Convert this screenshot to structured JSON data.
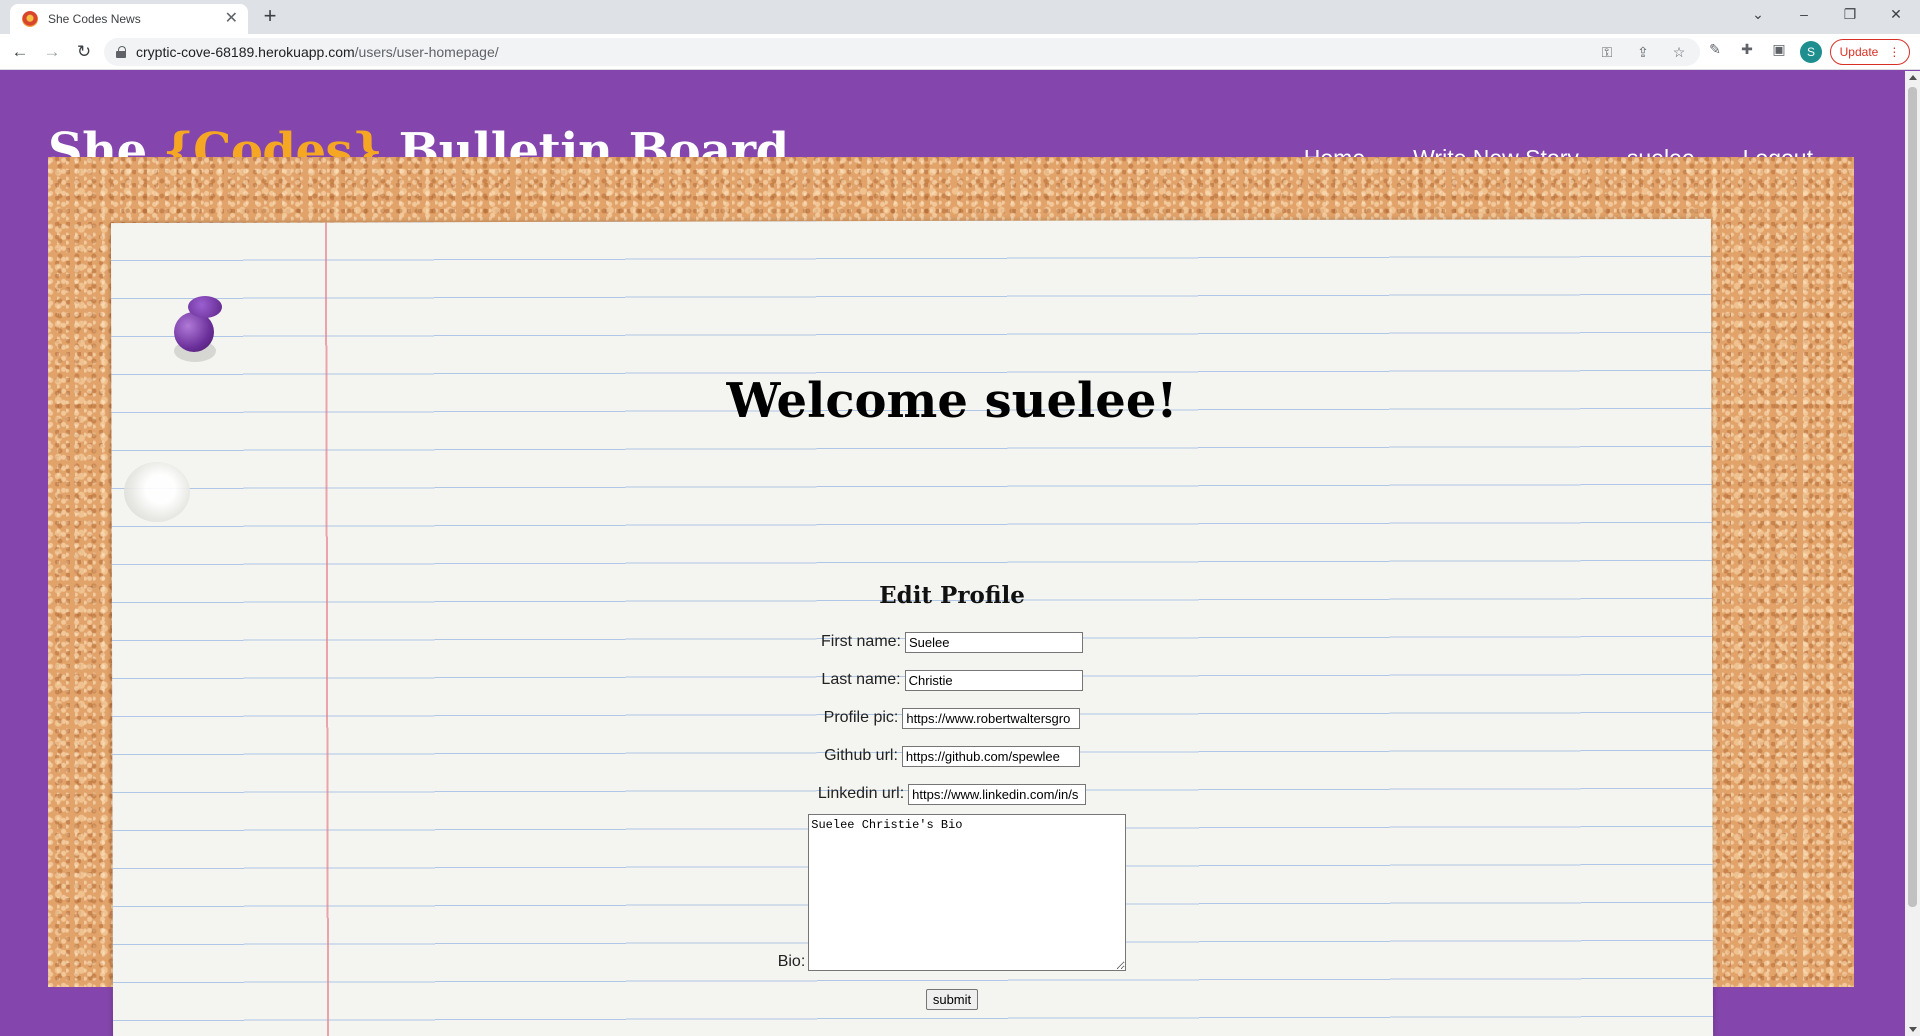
{
  "browser": {
    "tab_title": "She Codes News",
    "tab_close": "✕",
    "new_tab": "+",
    "url_host": "cryptic-cove-68189.herokuapp.com",
    "url_path": "/users/user-homepage/",
    "profile_initial": "S",
    "update_label": "Update",
    "update_menu": "⋮",
    "icons": [
      "key-icon",
      "share-icon",
      "star-icon",
      "extension-icon",
      "puzzle-icon",
      "side-panel-icon"
    ]
  },
  "site": {
    "title_pre": "She ",
    "title_highlight": "{Codes}",
    "title_post": " Bulletin Board",
    "nav": {
      "home": "Home",
      "write": "Write New Story",
      "user": "suelee",
      "logout": "Logout"
    },
    "colors": {
      "background": "#8446ac",
      "brace": "#f5a623"
    }
  },
  "main": {
    "welcome": "Welcome suelee!",
    "form": {
      "heading": "Edit Profile",
      "first_name_label": "First name:",
      "first_name_value": "Suelee",
      "last_name_label": "Last name:",
      "last_name_value": "Christie",
      "profile_pic_label": "Profile pic:",
      "profile_pic_value": "https://www.robertwaltersgro",
      "github_label": "Github url:",
      "github_value": "https://github.com/spewlee",
      "linkedin_label": "Linkedin url:",
      "linkedin_value": "https://www.linkedin.com/in/s",
      "bio_label": "Bio:",
      "bio_value": "Suelee Christie's Bio",
      "submit_label": "submit"
    }
  }
}
